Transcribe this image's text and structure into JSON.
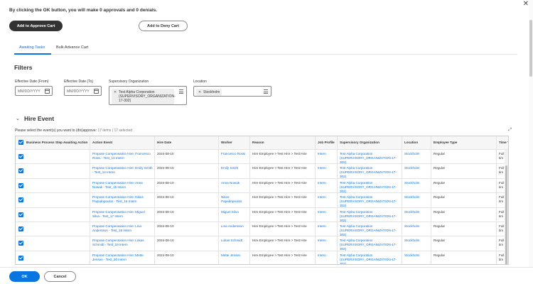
{
  "window": {
    "close_glyph": "✕"
  },
  "message": "By clicking the OK button, you will make 0 approvals and 0 denials.",
  "actions": {
    "approve_cart": "Add to Approve Cart",
    "deny_cart": "Add to Deny Cart"
  },
  "tabs": [
    {
      "label": "Awaiting Tasks",
      "active": true
    },
    {
      "label": "Bulk Advance Cart",
      "active": false
    }
  ],
  "filters": {
    "heading": "Filters",
    "effective_from": {
      "label": "Effective Date (From)",
      "placeholder": "MM/DD/YYYY"
    },
    "effective_to": {
      "label": "Effective Date (To)",
      "placeholder": "MM/DD/YYYY"
    },
    "supervisory_org": {
      "label": "Supervisory Organization",
      "value": "Test Alpha Corporation (SUPERVISORY_ORGANIZATION-17-302)"
    },
    "location": {
      "label": "Location",
      "value": "Stockholm"
    }
  },
  "section": {
    "title": "Hire Event",
    "select_prompt": "Please select the event(s) you want to (dis)approve:",
    "items_count": "17 items",
    "selected_count": "17 selected"
  },
  "grid": {
    "columns": [
      "Business Process Step Awaiting Action",
      "Action Event",
      "Hire Date",
      "Worker",
      "Reason",
      "Job Profile",
      "Supervisory Organization",
      "Location",
      "Employee Type",
      "Time T"
    ],
    "rows": [
      {
        "checked": true,
        "action_event": "Propose Compensation Hire: Francesco Rossi - Test_13 Intern",
        "hire_date": "2024-08-10",
        "worker": "Francesco Rossi",
        "reason": "Hire Employee > Test Hire > Test Hire",
        "job_profile": "Intern",
        "sup_org": "Test Alpha Corporation (SUPERVISORY_ORGANIZATION-17-302)",
        "location": "Stockholm",
        "employee_type": "Regular",
        "time_type": "Full tim"
      },
      {
        "checked": true,
        "action_event": "Propose Compensation Hire: Emily Smith - Test_14 Intern",
        "hire_date": "2024-08-10",
        "worker": "Emily Smith",
        "reason": "Hire Employee > Test Hire > Test Hire",
        "job_profile": "Intern",
        "sup_org": "Test Alpha Corporation (SUPERVISORY_ORGANIZATION-17-302)",
        "location": "Stockholm",
        "employee_type": "Regular",
        "time_type": "Full tim"
      },
      {
        "checked": true,
        "action_event": "Propose Compensation Hire: Anna Nowak - Test_15 Intern",
        "hire_date": "2024-08-10",
        "worker": "Anna Nowak",
        "reason": "Hire Employee > Test Hire > Test Hire",
        "job_profile": "Intern",
        "sup_org": "Test Alpha Corporation (SUPERVISORY_ORGANIZATION-17-302)",
        "location": "Stockholm",
        "employee_type": "Regular",
        "time_type": "Full tim"
      },
      {
        "checked": true,
        "action_event": "Propose Compensation Hire: Nikos Papadopoulos - Test_16 Intern",
        "hire_date": "2024-08-10",
        "worker": "Nikos Papadopoulos",
        "reason": "Hire Employee > Test Hire > Test Hire",
        "job_profile": "Intern",
        "sup_org": "Test Alpha Corporation (SUPERVISORY_ORGANIZATION-17-302)",
        "location": "Stockholm",
        "employee_type": "Regular",
        "time_type": "Full tim"
      },
      {
        "checked": true,
        "action_event": "Propose Compensation Hire: Miguel Silva - Test_17 Intern",
        "hire_date": "2024-08-10",
        "worker": "Miguel Silva",
        "reason": "Hire Employee > Test Hire > Test Hire",
        "job_profile": "Intern",
        "sup_org": "Test Alpha Corporation (SUPERVISORY_ORGANIZATION-17-302)",
        "location": "Stockholm",
        "employee_type": "Regular",
        "time_type": "Full tim"
      },
      {
        "checked": true,
        "action_event": "Propose Compensation Hire: Lina Andersson - Test_18 Intern",
        "hire_date": "2024-08-10",
        "worker": "Lina Andersson",
        "reason": "Hire Employee > Test Hire > Test Hire",
        "job_profile": "Intern",
        "sup_org": "Test Alpha Corporation (SUPERVISORY_ORGANIZATION-17-302)",
        "location": "Stockholm",
        "employee_type": "Regular",
        "time_type": "Full tim"
      },
      {
        "checked": true,
        "action_event": "Propose Compensation Hire: Lukas Schmidt - Test_19 Intern",
        "hire_date": "2024-08-10",
        "worker": "Lukas Schmidt",
        "reason": "Hire Employee > Test Hire > Test Hire",
        "job_profile": "Intern",
        "sup_org": "Test Alpha Corporation (SUPERVISORY_ORGANIZATION-17-302)",
        "location": "Stockholm",
        "employee_type": "Regular",
        "time_type": "Full tim"
      },
      {
        "checked": true,
        "action_event": "Propose Compensation Hire: Mette Jensen - Test_20 Intern",
        "hire_date": "2024-08-10",
        "worker": "Mette Jensen",
        "reason": "Hire Employee > Test Hire > Test Hire",
        "job_profile": "Intern",
        "sup_org": "Test Alpha Corporation (SUPERVISORY_ORGANIZATION-17-302)",
        "location": "Stockholm",
        "employee_type": "Regular",
        "time_type": "Full tim"
      }
    ]
  },
  "footer": {
    "ok": "OK",
    "cancel": "Cancel"
  },
  "colors": {
    "accent": "#0875e1",
    "dark_button": "#333333"
  }
}
